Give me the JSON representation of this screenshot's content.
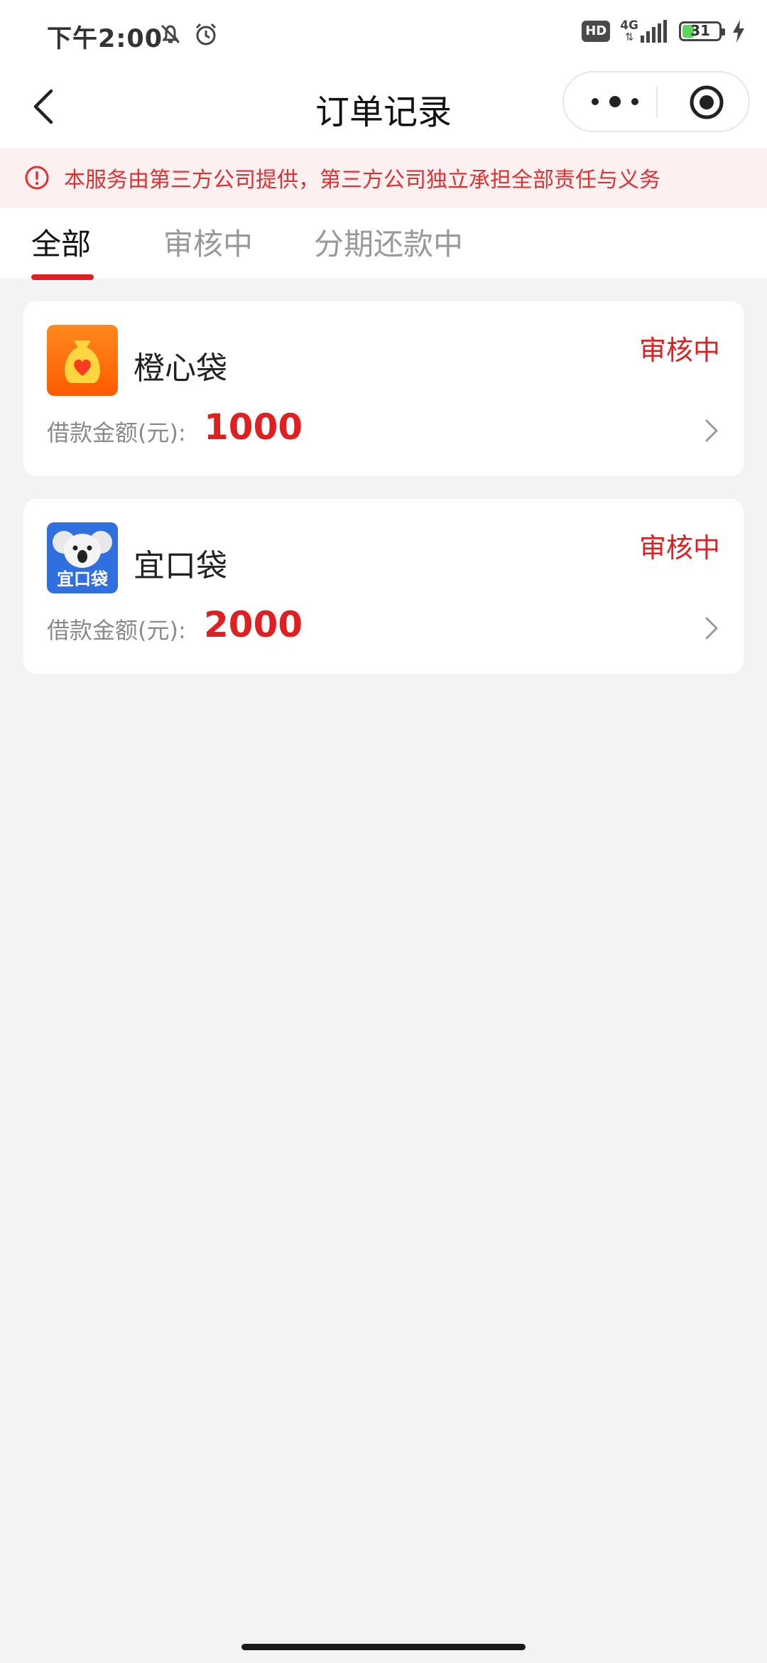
{
  "status_bar": {
    "time": "下午2:00",
    "hd": "HD",
    "network": "4G",
    "battery": "31",
    "battery_level_percent": 31
  },
  "navbar": {
    "title": "订单记录"
  },
  "notice": {
    "text": "本服务由第三方公司提供，第三方公司独立承担全部责任与义务"
  },
  "tabs": [
    {
      "label": "全部",
      "active": true
    },
    {
      "label": "审核中",
      "active": false
    },
    {
      "label": "分期还款中",
      "active": false
    }
  ],
  "orders": [
    {
      "name": "橙心袋",
      "status": "审核中",
      "amount_label": "借款金额(元):",
      "amount": "1000",
      "logo": "money-bag-heart-icon"
    },
    {
      "name": "宜口袋",
      "status": "审核中",
      "amount_label": "借款金额(元):",
      "amount": "2000",
      "logo": "koala-icon",
      "logo_text": "宜口袋"
    }
  ],
  "colors": {
    "accent_red": "#e02020",
    "notice_bg": "#fdf0f0",
    "page_bg": "#f3f3f3"
  }
}
